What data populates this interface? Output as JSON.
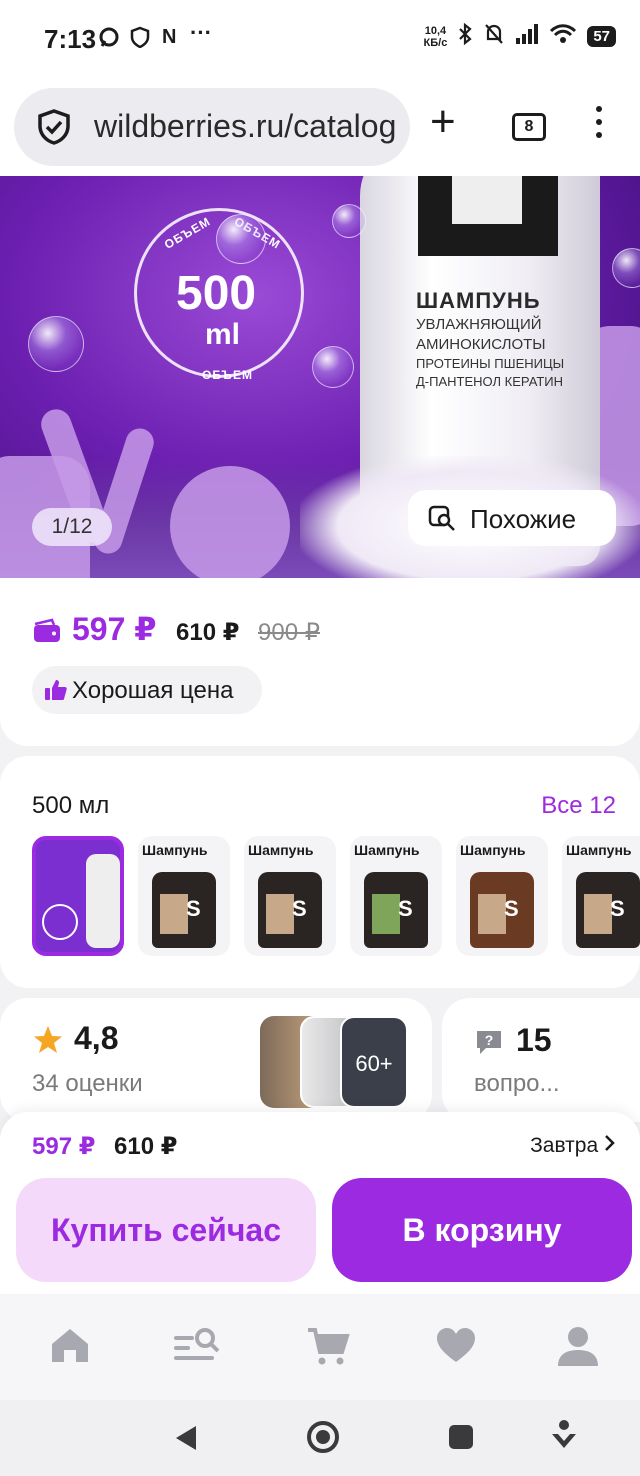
{
  "status_bar": {
    "time": "7:13",
    "net_speed_value": "10,4",
    "net_speed_unit": "КБ/с",
    "battery": "57",
    "icons": [
      "messenger-icon",
      "shield-icon",
      "n-icon",
      "more-dots-icon",
      "bluetooth-icon",
      "mute-icon",
      "signal-icon",
      "wifi-icon",
      "battery-icon"
    ]
  },
  "browser": {
    "url": "wildberries.ru/catalog",
    "tab_count": "8"
  },
  "hero": {
    "pager": "1/12",
    "similar_label": "Похожие",
    "seal_volume": "500",
    "seal_unit": "ml",
    "seal_word": "ОБЪЕМ",
    "product_brand": "ШАМПУНЬ",
    "product_lines": [
      "УВЛАЖНЯЮЩИЙ",
      "АМИНОКИСЛОТЫ",
      "ПРОТЕИНЫ ПШЕНИЦЫ",
      "Д-ПАНТЕНОЛ КЕРАТИН"
    ]
  },
  "price": {
    "current": "597 ₽",
    "second": "610 ₽",
    "old": "900 ₽",
    "badge_label": "Хорошая цена"
  },
  "variants": {
    "title": "500 мл",
    "all_label": "Все 12",
    "items": [
      {
        "label": "",
        "selected": true
      },
      {
        "label": "Шампунь",
        "selected": false
      },
      {
        "label": "Шампунь",
        "selected": false
      },
      {
        "label": "Шампунь",
        "selected": false
      },
      {
        "label": "Шампунь",
        "selected": false
      },
      {
        "label": "Шампунь",
        "selected": false
      }
    ]
  },
  "rating": {
    "value": "4,8",
    "count": "34 оценки",
    "photos_more": "60+"
  },
  "questions": {
    "value": "15",
    "label": "вопро..."
  },
  "buy_bar": {
    "price": "597 ₽",
    "price2": "610 ₽",
    "delivery": "Завтра",
    "buy_now": "Купить сейчас",
    "to_cart": "В корзину"
  },
  "bottom_nav": [
    "home-icon",
    "catalog-search-icon",
    "cart-icon",
    "favorites-icon",
    "profile-icon"
  ],
  "colors": {
    "accent": "#9b2ae0",
    "accent_light": "#f5d9fa",
    "background": "#f2f2f5"
  }
}
